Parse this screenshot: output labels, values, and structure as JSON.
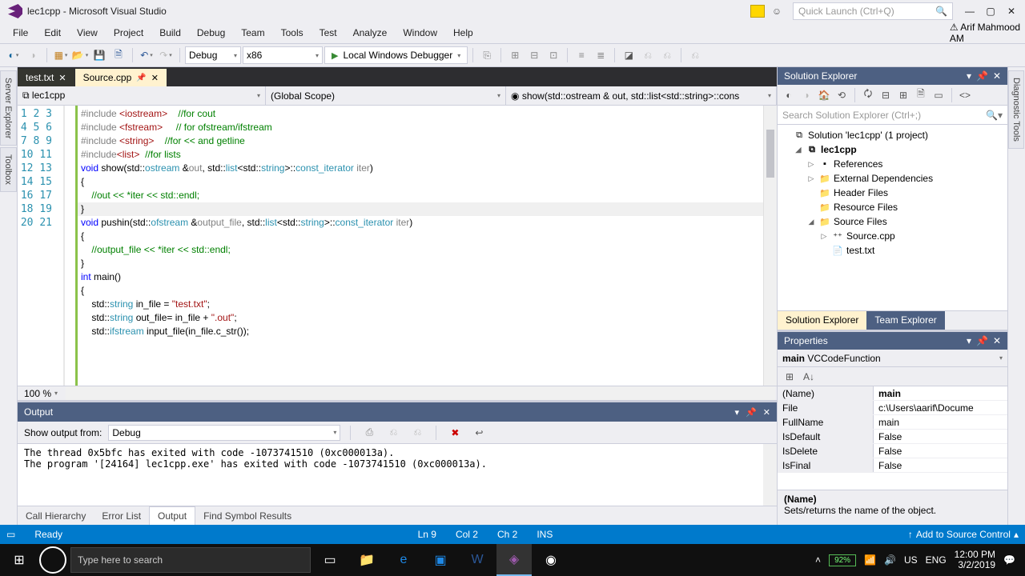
{
  "title": "lec1cpp - Microsoft Visual Studio",
  "quick_launch_placeholder": "Quick Launch (Ctrl+Q)",
  "user_name": "Arif Mahmood",
  "user_initials": "AM",
  "menu": [
    "File",
    "Edit",
    "View",
    "Project",
    "Build",
    "Debug",
    "Team",
    "Tools",
    "Test",
    "Analyze",
    "Window",
    "Help"
  ],
  "config": "Debug",
  "platform": "x86",
  "debugger": "Local Windows Debugger",
  "left_tabs": [
    "Server Explorer",
    "Toolbox"
  ],
  "right_tabs": [
    "Diagnostic Tools"
  ],
  "doc_tabs": [
    {
      "name": "test.txt",
      "active": false
    },
    {
      "name": "Source.cpp",
      "active": true,
      "pinned": true
    }
  ],
  "nav": {
    "scope1": "lec1cpp",
    "scope2": "(Global Scope)",
    "scope3": "show(std::ostream & out, std::list<std::string>::cons"
  },
  "code_lines": [
    {
      "n": 1,
      "h": "<span class='pp'>#include</span> <span class='str'>&lt;iostream&gt;</span>    <span class='cmt'>//for cout</span>"
    },
    {
      "n": 2,
      "h": "<span class='pp'>#include</span> <span class='str'>&lt;fstream&gt;</span>     <span class='cmt'>// for ofstream/ifstream</span>"
    },
    {
      "n": 3,
      "h": "<span class='pp'>#include</span> <span class='str'>&lt;string&gt;</span>    <span class='cmt'>//for &lt;&lt; and getline</span>"
    },
    {
      "n": 4,
      "h": "<span class='pp'>#include</span><span class='str'>&lt;list&gt;</span>  <span class='cmt'>//for lists</span>"
    },
    {
      "n": 5,
      "h": ""
    },
    {
      "n": 6,
      "h": "<span class='kw'>void</span> show(std::<span class='typ'>ostream</span> &amp;<span class='pp'>out</span>, std::<span class='typ'>list</span>&lt;std::<span class='typ'>string</span>&gt;::<span class='typ'>const_iterator</span> <span class='pp'>iter</span>)"
    },
    {
      "n": 7,
      "h": "{"
    },
    {
      "n": 8,
      "h": "    <span class='cmt'>//out &lt;&lt; *iter &lt;&lt; std::endl;</span>"
    },
    {
      "n": 9,
      "h": "}"
    },
    {
      "n": 10,
      "h": ""
    },
    {
      "n": 11,
      "h": "<span class='kw'>void</span> pushin(std::<span class='typ'>ofstream</span> &amp;<span class='pp'>output_file</span>, std::<span class='typ'>list</span>&lt;std::<span class='typ'>string</span>&gt;::<span class='typ'>const_iterator</span> <span class='pp'>iter</span>)"
    },
    {
      "n": 12,
      "h": "{"
    },
    {
      "n": 13,
      "h": "    <span class='cmt'>//output_file &lt;&lt; *iter &lt;&lt; std::endl;</span>"
    },
    {
      "n": 14,
      "h": "}"
    },
    {
      "n": 15,
      "h": ""
    },
    {
      "n": 16,
      "h": "<span class='kw'>int</span> main()"
    },
    {
      "n": 17,
      "h": "{"
    },
    {
      "n": 18,
      "h": "    std::<span class='typ'>string</span> in_file = <span class='str'>\"test.txt\"</span>;"
    },
    {
      "n": 19,
      "h": "    std::<span class='typ'>string</span> out_file= in_file + <span class='str'>\".out\"</span>;"
    },
    {
      "n": 20,
      "h": ""
    },
    {
      "n": 21,
      "h": "    std::<span class='typ'>ifstream</span> input_file(in_file.c_str());"
    }
  ],
  "zoom": "100 %",
  "output": {
    "title": "Output",
    "from_label": "Show output from:",
    "from_value": "Debug",
    "lines": [
      "The thread 0x5bfc has exited with code -1073741510 (0xc000013a).",
      "The program '[24164] lec1cpp.exe' has exited with code -1073741510 (0xc000013a)."
    ]
  },
  "bottom_tabs": [
    "Call Hierarchy",
    "Error List",
    "Output",
    "Find Symbol Results"
  ],
  "bottom_active": "Output",
  "solution_explorer": {
    "title": "Solution Explorer",
    "search_placeholder": "Search Solution Explorer (Ctrl+;)",
    "tree": [
      {
        "indent": 0,
        "exp": "",
        "icon": "⧉",
        "label": "Solution 'lec1cpp' (1 project)"
      },
      {
        "indent": 1,
        "exp": "◢",
        "icon": "⧉",
        "label": "lec1cpp",
        "bold": true
      },
      {
        "indent": 2,
        "exp": "▷",
        "icon": "▪",
        "label": "References"
      },
      {
        "indent": 2,
        "exp": "▷",
        "icon": "📁",
        "label": "External Dependencies"
      },
      {
        "indent": 2,
        "exp": "",
        "icon": "📁",
        "label": "Header Files"
      },
      {
        "indent": 2,
        "exp": "",
        "icon": "📁",
        "label": "Resource Files"
      },
      {
        "indent": 2,
        "exp": "◢",
        "icon": "📁",
        "label": "Source Files"
      },
      {
        "indent": 3,
        "exp": "▷",
        "icon": "⁺⁺",
        "label": "Source.cpp"
      },
      {
        "indent": 3,
        "exp": "",
        "icon": "📄",
        "label": "test.txt"
      }
    ],
    "tabs": [
      "Solution Explorer",
      "Team Explorer"
    ]
  },
  "properties": {
    "title": "Properties",
    "object": "main VCCodeFunction",
    "rows": [
      {
        "name": "(Name)",
        "value": "main",
        "bold": true
      },
      {
        "name": "File",
        "value": "c:\\Users\\aarif\\Docume"
      },
      {
        "name": "FullName",
        "value": "main"
      },
      {
        "name": "IsDefault",
        "value": "False"
      },
      {
        "name": "IsDelete",
        "value": "False"
      },
      {
        "name": "IsFinal",
        "value": "False"
      }
    ],
    "desc_name": "(Name)",
    "desc_text": "Sets/returns the name of the object."
  },
  "status": {
    "ready": "Ready",
    "ln": "Ln 9",
    "col": "Col 2",
    "ch": "Ch 2",
    "ins": "INS",
    "source_control": "Add to Source Control"
  },
  "taskbar": {
    "search_placeholder": "Type here to search",
    "battery": "92%",
    "lang1": "US",
    "lang2": "ENG",
    "time": "12:00 PM",
    "date": "3/2/2019"
  }
}
